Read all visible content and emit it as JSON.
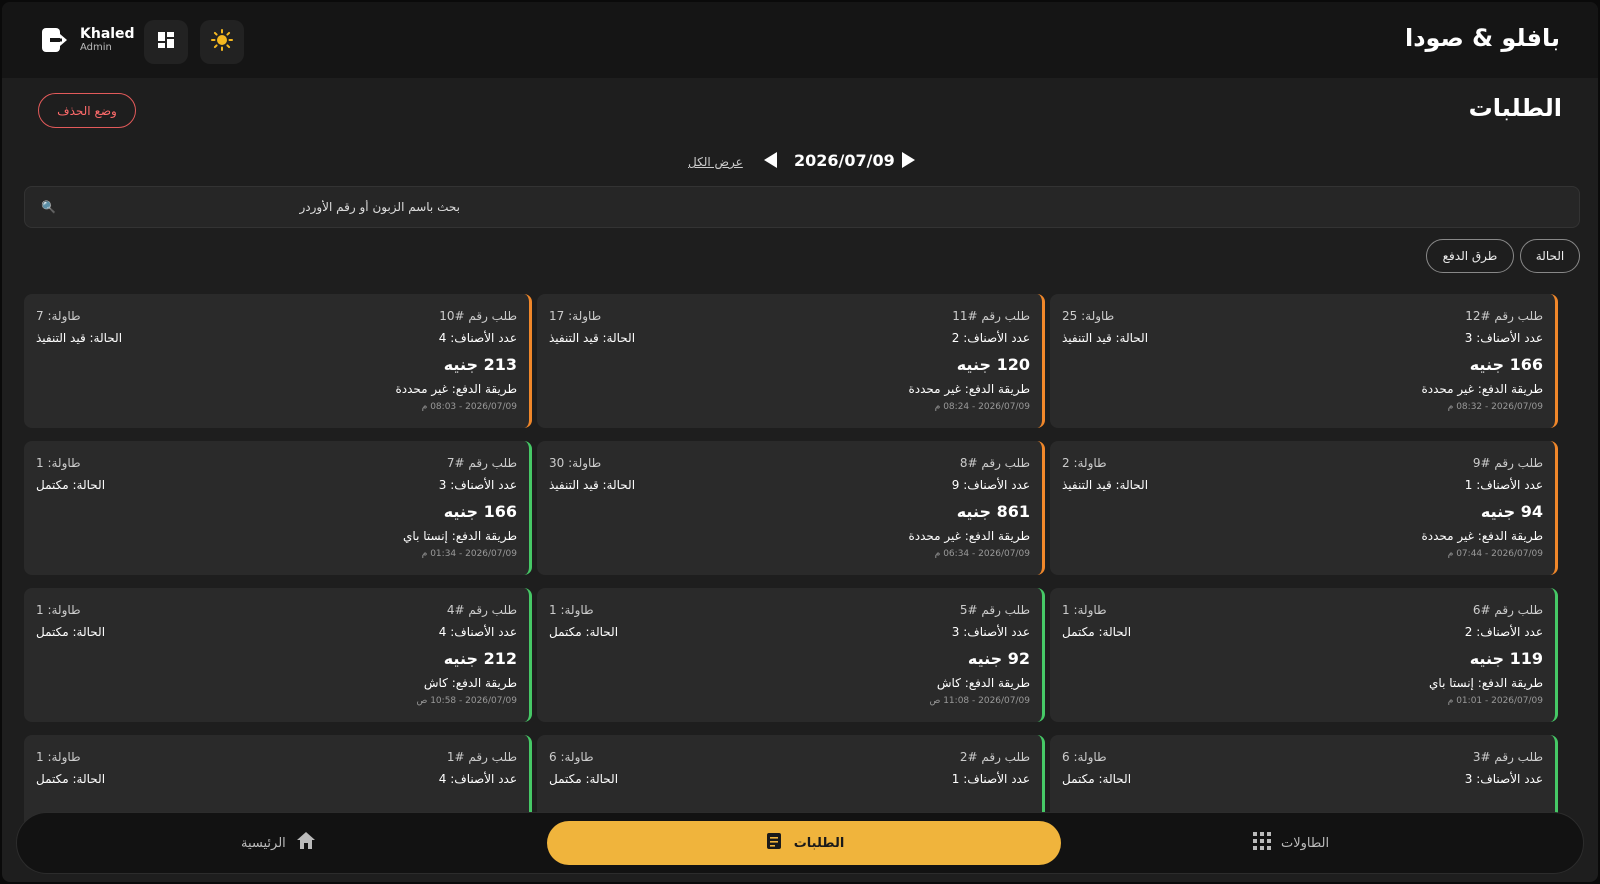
{
  "header": {
    "brand": "بافلو & صودا",
    "user_name": "Khaled",
    "user_role": "Admin"
  },
  "page": {
    "title": "الطلبات",
    "delete_mode_label": "وضع الحذف",
    "date": "2026/07/09",
    "show_all_label": "عرض الكل",
    "search_placeholder": "بحث باسم الزبون أو رقم الأوردر",
    "filters": {
      "status": "الحالة",
      "payment_methods": "طرق الدفع"
    }
  },
  "colors": {
    "in_progress": "#f0872a",
    "completed": "#46c866",
    "accent": "#f0b43c"
  },
  "orders": [
    {
      "order_no": "طلب رقم #12",
      "table": "طاولة: 25",
      "items": "عدد الأصناف: 3",
      "status": "الحالة: قيد التنفيذ",
      "price": "166 جنيه",
      "payment": "طريقة الدفع: غير محددة",
      "date": "2026/07/09 - 08:32 م",
      "state": "in_progress"
    },
    {
      "order_no": "طلب رقم #11",
      "table": "طاولة: 17",
      "items": "عدد الأصناف: 2",
      "status": "الحالة: قيد التنفيذ",
      "price": "120 جنيه",
      "payment": "طريقة الدفع: غير محددة",
      "date": "2026/07/09 - 08:24 م",
      "state": "in_progress"
    },
    {
      "order_no": "طلب رقم #10",
      "table": "طاولة: 7",
      "items": "عدد الأصناف: 4",
      "status": "الحالة: قيد التنفيذ",
      "price": "213 جنيه",
      "payment": "طريقة الدفع: غير محددة",
      "date": "2026/07/09 - 08:03 م",
      "state": "in_progress"
    },
    {
      "order_no": "طلب رقم #9",
      "table": "طاولة: 2",
      "items": "عدد الأصناف: 1",
      "status": "الحالة: قيد التنفيذ",
      "price": "94 جنيه",
      "payment": "طريقة الدفع: غير محددة",
      "date": "2026/07/09 - 07:44 م",
      "state": "in_progress"
    },
    {
      "order_no": "طلب رقم #8",
      "table": "طاولة: 30",
      "items": "عدد الأصناف: 9",
      "status": "الحالة: قيد التنفيذ",
      "price": "861 جنيه",
      "payment": "طريقة الدفع: غير محددة",
      "date": "2026/07/09 - 06:34 م",
      "state": "in_progress"
    },
    {
      "order_no": "طلب رقم #7",
      "table": "طاولة: 1",
      "items": "عدد الأصناف: 3",
      "status": "الحالة: مكتمل",
      "price": "166 جنيه",
      "payment": "طريقة الدفع: إنستا باي",
      "date": "2026/07/09 - 01:34 م",
      "state": "completed"
    },
    {
      "order_no": "طلب رقم #6",
      "table": "طاولة: 1",
      "items": "عدد الأصناف: 2",
      "status": "الحالة: مكتمل",
      "price": "119 جنيه",
      "payment": "طريقة الدفع: إنستا باي",
      "date": "2026/07/09 - 01:01 م",
      "state": "completed"
    },
    {
      "order_no": "طلب رقم #5",
      "table": "طاولة: 1",
      "items": "عدد الأصناف: 3",
      "status": "الحالة: مكتمل",
      "price": "92 جنيه",
      "payment": "طريقة الدفع: كاش",
      "date": "2026/07/09 - 11:08 ص",
      "state": "completed"
    },
    {
      "order_no": "طلب رقم #4",
      "table": "طاولة: 1",
      "items": "عدد الأصناف: 4",
      "status": "الحالة: مكتمل",
      "price": "212 جنيه",
      "payment": "طريقة الدفع: كاش",
      "date": "2026/07/09 - 10:58 ص",
      "state": "completed"
    },
    {
      "order_no": "طلب رقم #3",
      "table": "طاولة: 6",
      "items": "عدد الأصناف: 3",
      "status": "الحالة: مكتمل",
      "price": "",
      "payment": "",
      "date": "",
      "state": "completed"
    },
    {
      "order_no": "طلب رقم #2",
      "table": "طاولة: 6",
      "items": "عدد الأصناف: 1",
      "status": "الحالة: مكتمل",
      "price": "",
      "payment": "",
      "date": "",
      "state": "completed"
    },
    {
      "order_no": "طلب رقم #1",
      "table": "طاولة: 1",
      "items": "عدد الأصناف: 4",
      "status": "الحالة: مكتمل",
      "price": "",
      "payment": "",
      "date": "",
      "state": "completed"
    }
  ],
  "bottom_nav": {
    "tables": "الطاولات",
    "orders": "الطلبات",
    "home": "الرئيسية"
  }
}
